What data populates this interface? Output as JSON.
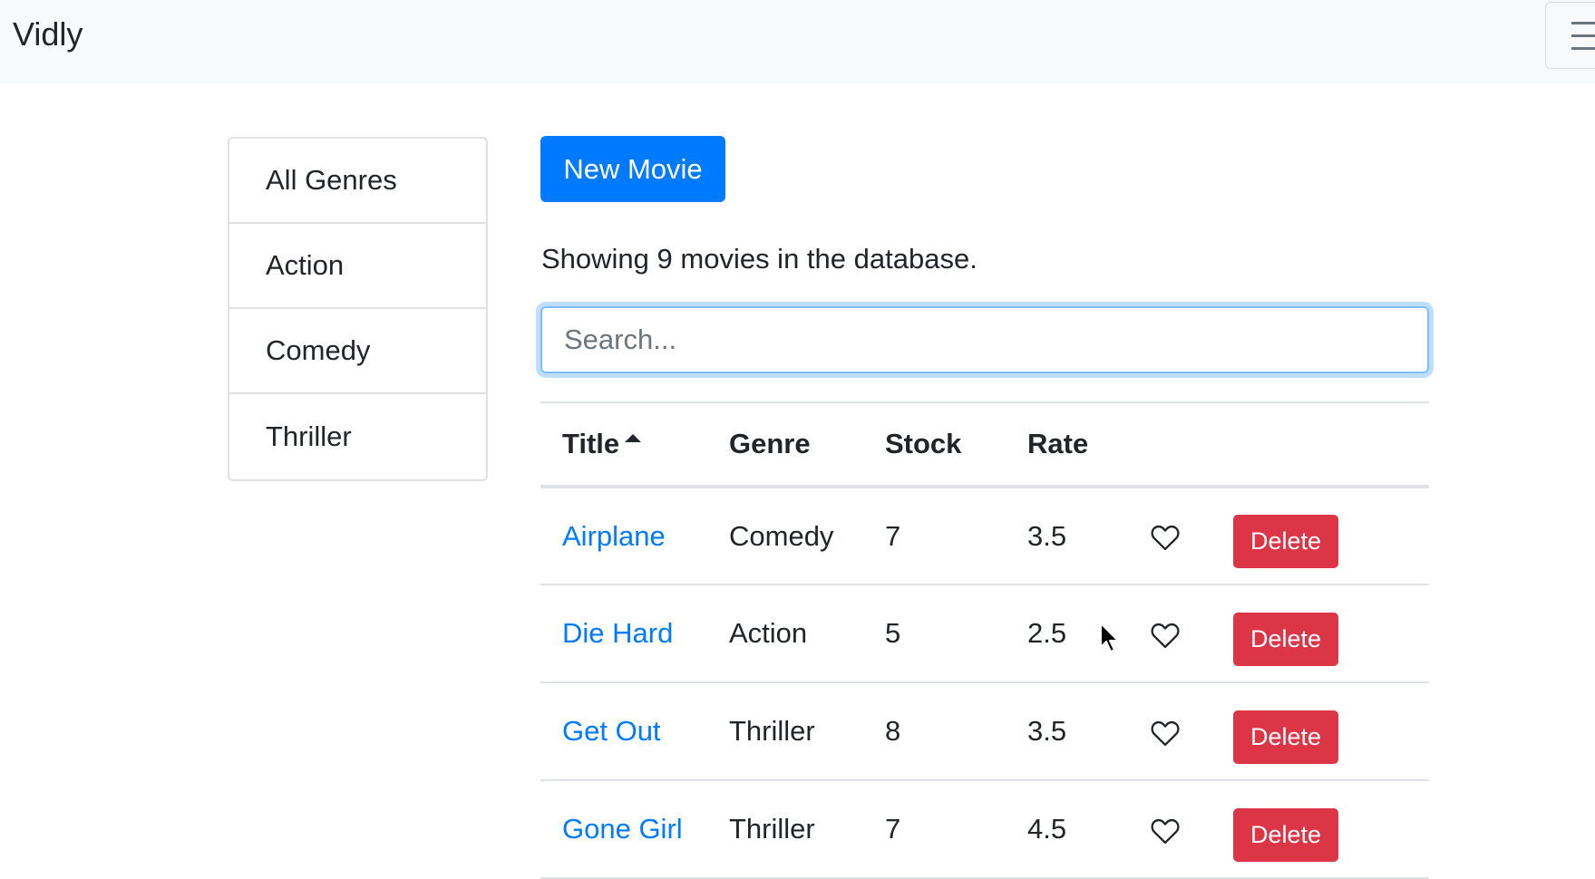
{
  "navbar": {
    "brand": "Vidly",
    "toggler_icon": "hamburger-icon"
  },
  "genres": [
    "All Genres",
    "Action",
    "Comedy",
    "Thriller"
  ],
  "new_movie_label": "New Movie",
  "summary": "Showing 9 movies in the database.",
  "search": {
    "placeholder": "Search...",
    "value": ""
  },
  "table": {
    "columns": {
      "title": "Title",
      "genre": "Genre",
      "stock": "Stock",
      "rate": "Rate"
    },
    "sort": {
      "column": "Title",
      "direction": "asc"
    },
    "rows": [
      {
        "title": "Airplane",
        "genre": "Comedy",
        "stock": "7",
        "rate": "3.5",
        "liked": false,
        "delete_label": "Delete"
      },
      {
        "title": "Die Hard",
        "genre": "Action",
        "stock": "5",
        "rate": "2.5",
        "liked": false,
        "delete_label": "Delete"
      },
      {
        "title": "Get Out",
        "genre": "Thriller",
        "stock": "8",
        "rate": "3.5",
        "liked": false,
        "delete_label": "Delete"
      },
      {
        "title": "Gone Girl",
        "genre": "Thriller",
        "stock": "7",
        "rate": "4.5",
        "liked": false,
        "delete_label": "Delete"
      }
    ]
  },
  "colors": {
    "primary": "#007bff",
    "danger": "#dc3545",
    "navbar_bg": "#f8f9fa"
  }
}
